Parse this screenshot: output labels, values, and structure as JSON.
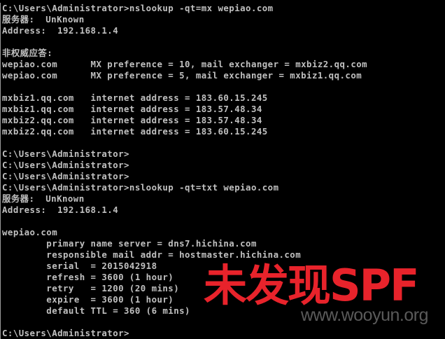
{
  "console": {
    "lines": [
      "C:\\Users\\Administrator>nslookup -qt=mx wepiao.com",
      "服务器:  UnKnown",
      "Address:  192.168.1.4",
      "",
      "非权威应答:",
      "wepiao.com      MX preference = 10, mail exchanger = mxbiz2.qq.com",
      "wepiao.com      MX preference = 5, mail exchanger = mxbiz1.qq.com",
      "",
      "mxbiz1.qq.com   internet address = 183.60.15.245",
      "mxbiz1.qq.com   internet address = 183.57.48.34",
      "mxbiz2.qq.com   internet address = 183.57.48.34",
      "mxbiz2.qq.com   internet address = 183.60.15.245",
      "",
      "C:\\Users\\Administrator>",
      "C:\\Users\\Administrator>",
      "C:\\Users\\Administrator>",
      "C:\\Users\\Administrator>nslookup -qt=txt wepiao.com",
      "服务器:  UnKnown",
      "Address:  192.168.1.4",
      "",
      "wepiao.com",
      "        primary name server = dns7.hichina.com",
      "        responsible mail addr = hostmaster.hichina.com",
      "        serial  = 2015042918",
      "        refresh = 3600 (1 hour)",
      "        retry   = 1200 (20 mins)",
      "        expire  = 3600 (1 hour)",
      "        default TTL = 360 (6 mins)",
      "",
      "C:\\Users\\Administrator>"
    ]
  },
  "overlay": {
    "annotation": "未发现SPF",
    "annotation_color": "#e8232b",
    "watermark": "www.wooyun.org"
  }
}
